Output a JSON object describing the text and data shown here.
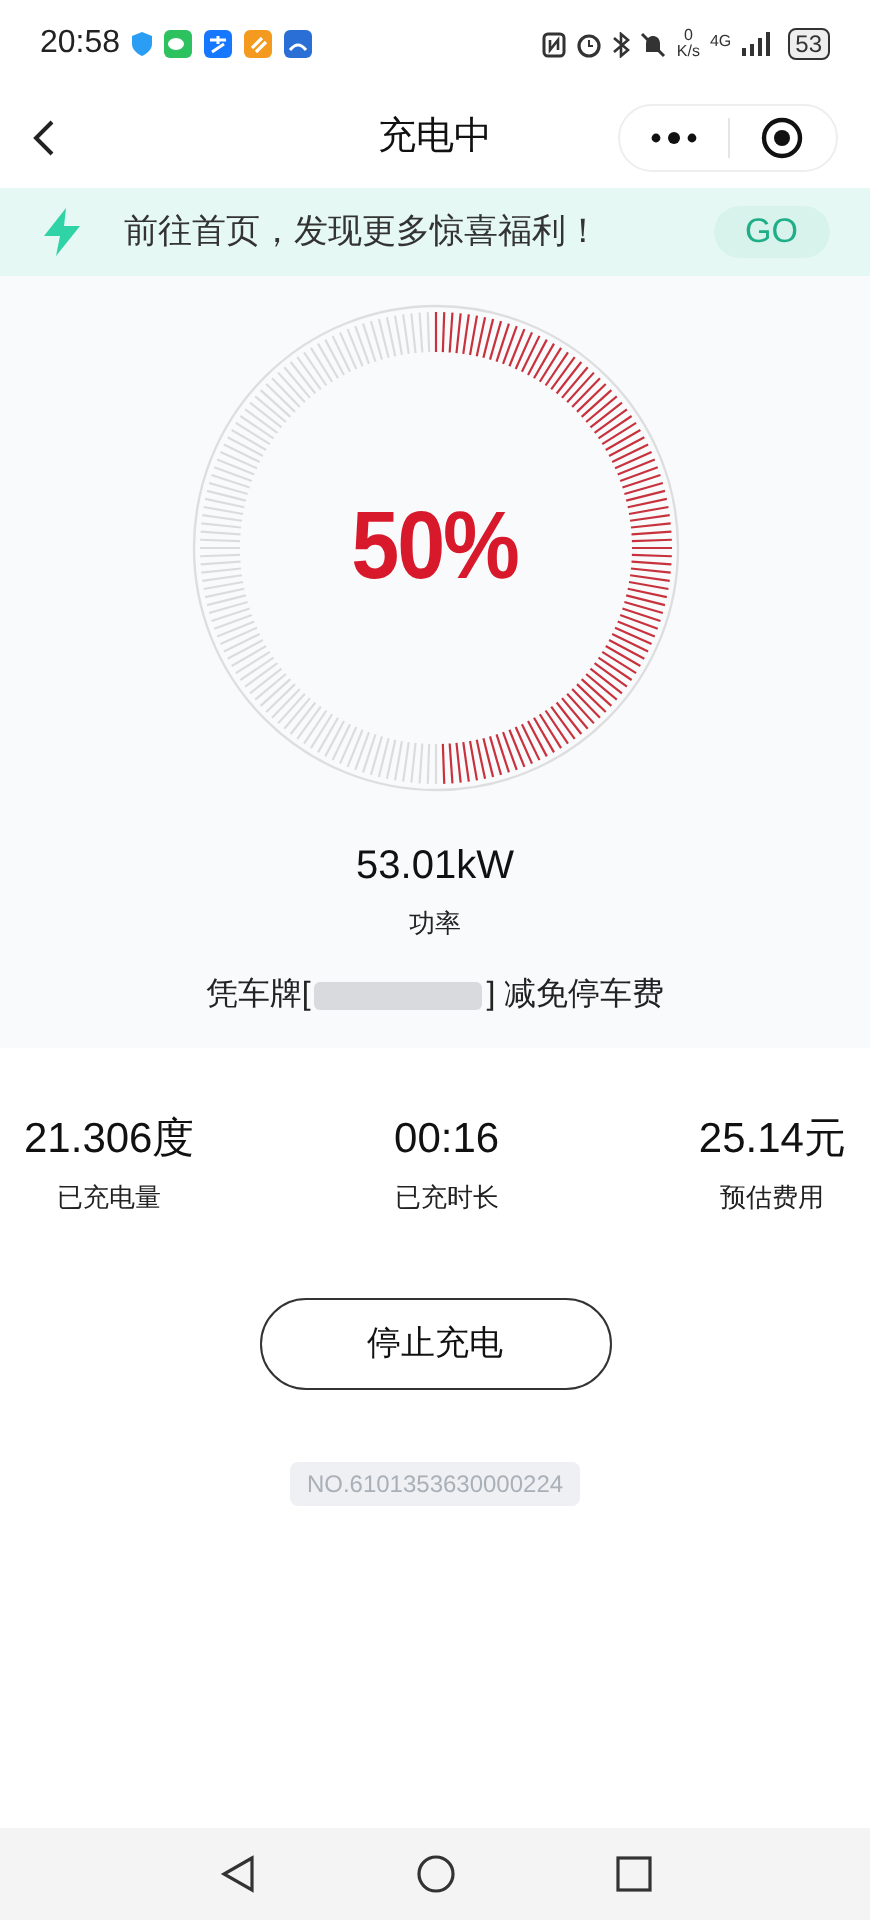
{
  "status_bar": {
    "time": "20:58",
    "net_speed_value": "0",
    "net_speed_unit": "K/s",
    "network": "4G",
    "battery": "53"
  },
  "nav": {
    "title": "充电中"
  },
  "banner": {
    "text": "前往首页，发现更多惊喜福利！",
    "button": "GO"
  },
  "gauge": {
    "percent": "50%"
  },
  "power": {
    "value": "53.01kW",
    "label": "功率"
  },
  "parking": {
    "prefix": "凭车牌[",
    "suffix": "] 减免停车费"
  },
  "stats": [
    {
      "value": "21.306度",
      "label": "已充电量"
    },
    {
      "value": "00:16",
      "label": "已充时长"
    },
    {
      "value": "25.14元",
      "label": "预估费用"
    }
  ],
  "stop_button": "停止充电",
  "order_no": "NO.6101353630000224"
}
